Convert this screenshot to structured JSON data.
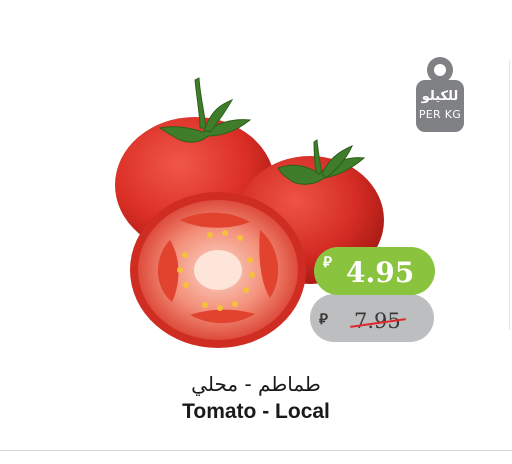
{
  "product": {
    "name_ar": "طماطم - محلي",
    "name_en": "Tomato - Local",
    "image_icon": "tomato-image"
  },
  "unit_badge": {
    "label_ar": "للكيلو",
    "label_en": "PER KG",
    "color": "#808184"
  },
  "pricing": {
    "currency_symbol": "⃁",
    "offer_price": "4.95",
    "regular_price": "7.95",
    "offer_color": "#8ac43f",
    "regular_color": "#bdbebf",
    "strike_color": "#e0292f"
  }
}
